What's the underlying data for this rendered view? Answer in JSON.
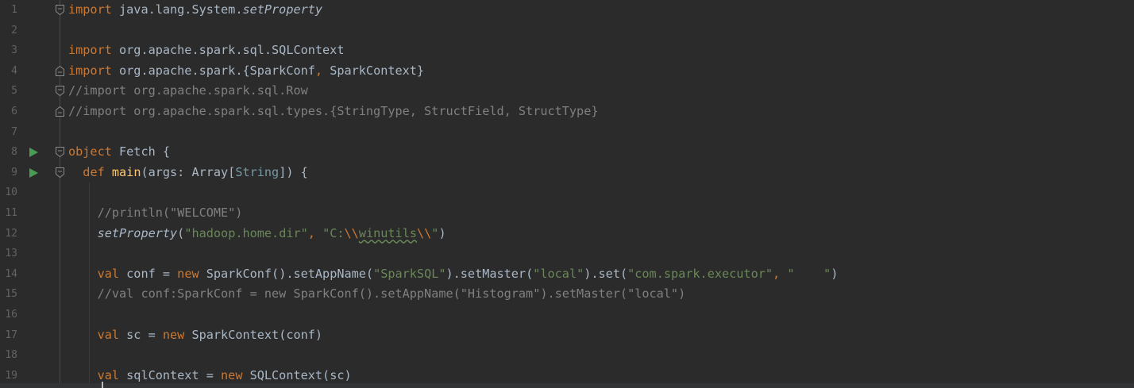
{
  "editor": {
    "lines": [
      {
        "n": "1",
        "tokens": [
          {
            "t": "import",
            "c": "kw"
          },
          {
            "t": " java.lang.System."
          },
          {
            "t": "setProperty",
            "c": "it"
          }
        ],
        "fold": "start"
      },
      {
        "n": "2",
        "tokens": []
      },
      {
        "n": "3",
        "tokens": [
          {
            "t": "import",
            "c": "kw"
          },
          {
            "t": " org.apache.spark.sql.SQLContext"
          }
        ]
      },
      {
        "n": "4",
        "tokens": [
          {
            "t": "import",
            "c": "kw"
          },
          {
            "t": " org.apache.spark.{SparkConf"
          },
          {
            "t": ",",
            "c": "kw"
          },
          {
            "t": " SparkContext}"
          }
        ],
        "fold": "end"
      },
      {
        "n": "5",
        "tokens": [
          {
            "t": "//import org.apache.spark.sql.Row",
            "c": "cm"
          }
        ],
        "fold": "start"
      },
      {
        "n": "6",
        "tokens": [
          {
            "t": "//import org.apache.spark.sql.types.{StringType, StructField, StructType}",
            "c": "cm"
          }
        ],
        "fold": "end"
      },
      {
        "n": "7",
        "tokens": []
      },
      {
        "n": "8",
        "tokens": [
          {
            "t": "object",
            "c": "kw"
          },
          {
            "t": " Fetch {"
          }
        ],
        "fold": "start",
        "run": true
      },
      {
        "n": "9",
        "tokens": [
          {
            "t": "  "
          },
          {
            "t": "def",
            "c": "kw"
          },
          {
            "t": " "
          },
          {
            "t": "main",
            "c": "fn"
          },
          {
            "t": "(args: Array["
          },
          {
            "t": "String",
            "c": "ty"
          },
          {
            "t": "]) {"
          }
        ],
        "fold": "start",
        "run": true
      },
      {
        "n": "10",
        "tokens": []
      },
      {
        "n": "11",
        "tokens": [
          {
            "t": "    "
          },
          {
            "t": "//println(\"WELCOME\")",
            "c": "cm"
          }
        ]
      },
      {
        "n": "12",
        "tokens": [
          {
            "t": "    "
          },
          {
            "t": "setProperty",
            "c": "it"
          },
          {
            "t": "("
          },
          {
            "t": "\"hadoop.home.dir\"",
            "c": "str"
          },
          {
            "t": ",",
            "c": "kw"
          },
          {
            "t": " "
          },
          {
            "t": "\"C:",
            "c": "str"
          },
          {
            "t": "\\\\",
            "c": "kw"
          },
          {
            "t": "winutils",
            "c": "str sq"
          },
          {
            "t": "\\\\",
            "c": "kw"
          },
          {
            "t": "\"",
            "c": "str"
          },
          {
            "t": ")"
          }
        ]
      },
      {
        "n": "13",
        "tokens": []
      },
      {
        "n": "14",
        "tokens": [
          {
            "t": "    "
          },
          {
            "t": "val",
            "c": "kw"
          },
          {
            "t": " conf = "
          },
          {
            "t": "new",
            "c": "kw"
          },
          {
            "t": " SparkConf().setAppName("
          },
          {
            "t": "\"SparkSQL\"",
            "c": "str"
          },
          {
            "t": ").setMaster("
          },
          {
            "t": "\"local\"",
            "c": "str"
          },
          {
            "t": ").set("
          },
          {
            "t": "\"com.spark.executor\"",
            "c": "str"
          },
          {
            "t": ",",
            "c": "kw"
          },
          {
            "t": " "
          },
          {
            "t": "\"    \"",
            "c": "str"
          },
          {
            "t": ")"
          }
        ]
      },
      {
        "n": "15",
        "tokens": [
          {
            "t": "    "
          },
          {
            "t": "//val conf:SparkConf = new SparkConf().setAppName(\"Histogram\").setMaster(\"local\")",
            "c": "cm"
          }
        ]
      },
      {
        "n": "16",
        "tokens": []
      },
      {
        "n": "17",
        "tokens": [
          {
            "t": "    "
          },
          {
            "t": "val",
            "c": "kw"
          },
          {
            "t": " sc = "
          },
          {
            "t": "new",
            "c": "kw"
          },
          {
            "t": " SparkContext(conf)"
          }
        ]
      },
      {
        "n": "18",
        "tokens": []
      },
      {
        "n": "19",
        "tokens": [
          {
            "t": "    "
          },
          {
            "t": "val",
            "c": "kw"
          },
          {
            "t": " sqlContext = "
          },
          {
            "t": "new",
            "c": "kw"
          },
          {
            "t": " SQLContext(sc)"
          }
        ]
      }
    ]
  }
}
